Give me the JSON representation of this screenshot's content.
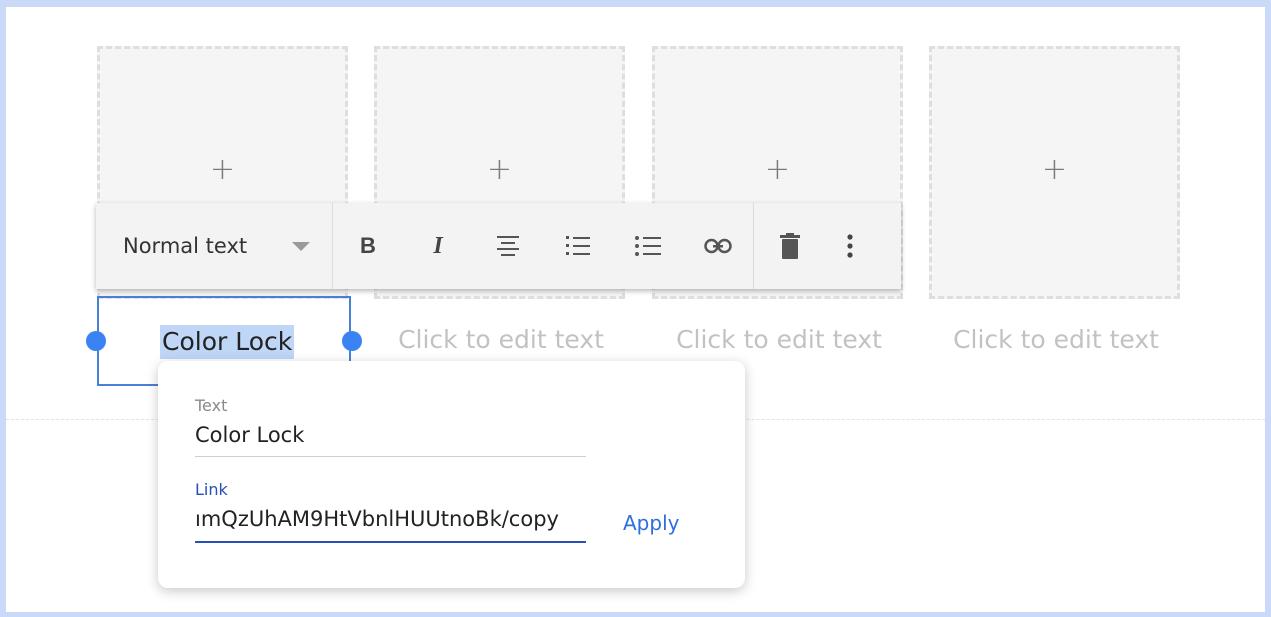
{
  "slots": [
    {
      "plus": "+",
      "caption": "Click to edit text"
    },
    {
      "plus": "+",
      "caption": "Click to edit text"
    },
    {
      "plus": "+",
      "caption": "Click to edit text"
    },
    {
      "plus": "+",
      "caption": "Click to edit text"
    }
  ],
  "selected_caption": "Color Lock",
  "toolbar": {
    "style_value": "Normal text",
    "buttons": [
      "bold-icon",
      "italic-icon",
      "align-center-icon",
      "numbered-list-icon",
      "bulleted-list-icon",
      "link-icon",
      "delete-icon",
      "more-vert-icon"
    ],
    "bold_glyph": "B",
    "italic_glyph": "I"
  },
  "link_popup": {
    "text_label": "Text",
    "text_value": "Color Lock",
    "link_label": "Link",
    "link_value": "ımQzUhAM9HtVbnlHUUtnoBk/copy",
    "apply_label": "Apply"
  },
  "colors": {
    "accent": "#3b82f4",
    "selection": "#bfd6f7",
    "link_label": "#2450b8",
    "frame": "#c9d9f7"
  }
}
